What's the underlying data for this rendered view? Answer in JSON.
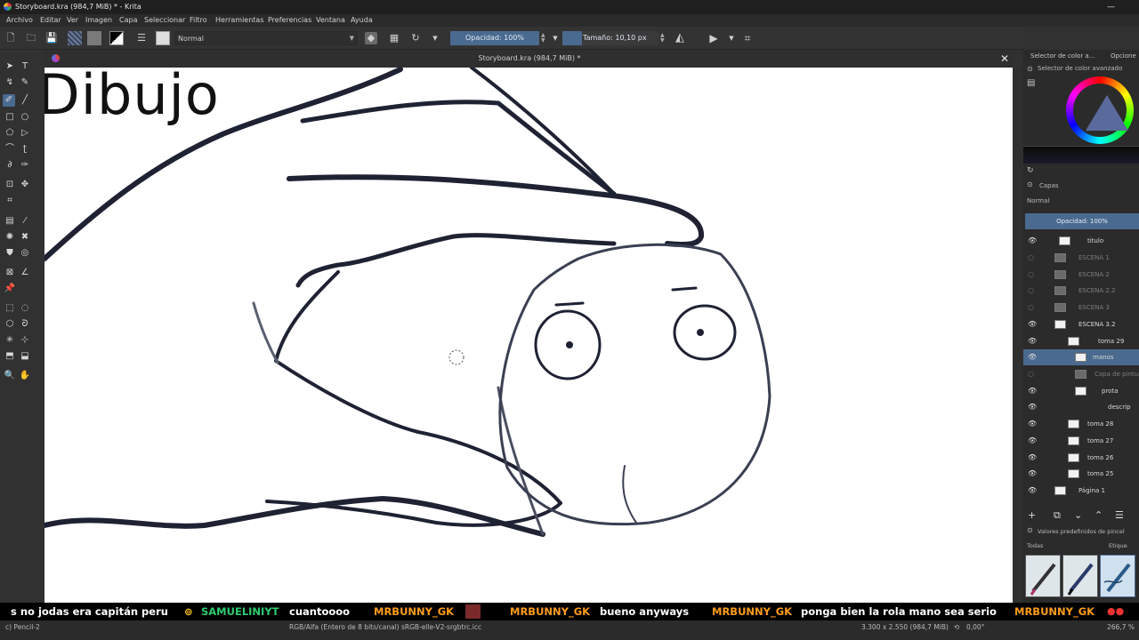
{
  "window": {
    "title": "Storyboard.kra (984,7 MiB) * - Krita"
  },
  "menu": [
    "Archivo",
    "Editar",
    "Ver",
    "Imagen",
    "Capa",
    "Seleccionar",
    "Filtro",
    "Herramientas",
    "Preferencias",
    "Ventana",
    "Ayuda"
  ],
  "toolbar": {
    "blend_mode": "Normal",
    "opacity_label": "Opacidad: 100%",
    "size_label": "Tamaño: 10,10 px"
  },
  "docker_tabs": [
    "Selector de color a...",
    "Opcione"
  ],
  "document": {
    "tab_title": "Storyboard.kra (984,7 MiB) *"
  },
  "canvas": {
    "heading": "Dibujo"
  },
  "color_docker": {
    "title": "Selector de color avanzado"
  },
  "layers": {
    "title": "Capas",
    "blend": "Normal",
    "opacity_label": "Opacidad:  100%",
    "items": [
      {
        "name": "titulo",
        "visible": true
      },
      {
        "name": "ESCENA 1",
        "visible": false
      },
      {
        "name": "ESCENA 2",
        "visible": false
      },
      {
        "name": "ESCENA 2.2",
        "visible": false
      },
      {
        "name": "ESCENA 3",
        "visible": false
      },
      {
        "name": "ESCENA 3.2",
        "visible": true
      },
      {
        "name": "toma 29",
        "visible": true
      },
      {
        "name": "manos",
        "visible": true,
        "selected": true
      },
      {
        "name": "Capa de pintura",
        "visible": false
      },
      {
        "name": "prota",
        "visible": true
      },
      {
        "name": "descrip",
        "visible": true
      },
      {
        "name": "toma 28",
        "visible": true
      },
      {
        "name": "toma 27",
        "visible": true
      },
      {
        "name": "toma 26",
        "visible": true
      },
      {
        "name": "toma 25",
        "visible": true
      },
      {
        "name": "Página 1",
        "visible": true
      }
    ]
  },
  "brush_presets": {
    "title": "Valores predefinidos de pincel",
    "filter": "Todas",
    "tag": "Etique"
  },
  "chat": {
    "m1": "s no jodas era capitán peru",
    "u2": "SAMUELINIYT",
    "m2": "cuantoooo",
    "u3": "MRBUNNY_GK",
    "u4": "MRBUNNY_GK",
    "m4": "bueno anyways",
    "u5": "MRBUNNY_GK",
    "m5": "ponga bien la rola mano sea serio",
    "u6": "MRBUNNY_GK"
  },
  "status": {
    "brush": "c) Pencil-2",
    "colorspace": "RGB/Alfa (Entero de 8 bits/canal)  sRGB-elle-V2-srgbtrc.icc",
    "dimensions": "3.300 x 2.550 (984,7 MiB)",
    "rotation": "0,00°",
    "zoom": "266,7 %"
  },
  "colors": {
    "accent": "#4a6a8f",
    "ink": "#1e2233",
    "chat_user_orange": "#ff9c1a",
    "chat_user_green": "#2ecc71"
  }
}
